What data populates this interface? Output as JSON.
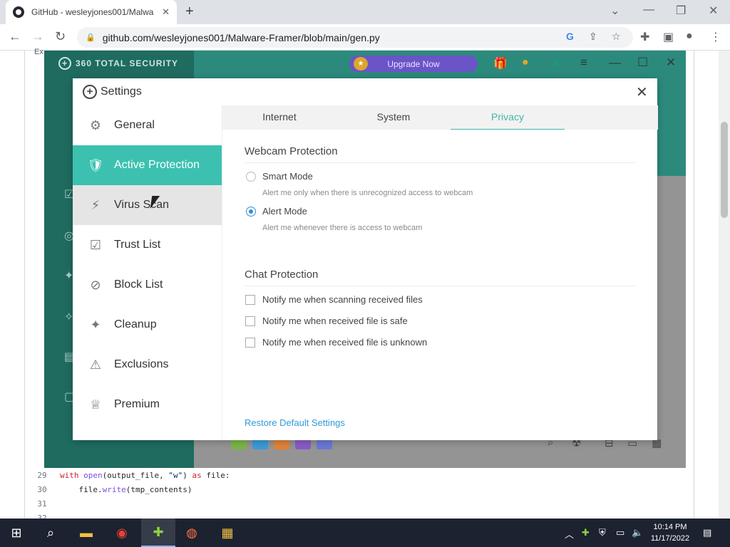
{
  "browser": {
    "tab_title": "GitHub - wesleyjones001/Malwa",
    "url": "github.com/wesleyjones001/Malware-Framer/blob/main/gen.py",
    "new_tab_glyph": "+",
    "close_tab_glyph": "✕"
  },
  "github_page": {
    "header_fragment": "Ex",
    "code_lines": [
      {
        "n": "29",
        "parts": [
          [
            "kw",
            "with "
          ],
          [
            "fn",
            "open"
          ],
          [
            "",
            "(output_file, "
          ],
          [
            "str",
            "\"w\""
          ],
          [
            "",
            ") "
          ],
          [
            "kw",
            "as "
          ],
          [
            "",
            "file:"
          ]
        ]
      },
      {
        "n": "30",
        "parts": [
          [
            "",
            "    file."
          ],
          [
            "fn",
            "write"
          ],
          [
            "",
            "(tmp_contents)"
          ]
        ]
      },
      {
        "n": "31",
        "parts": []
      },
      {
        "n": "32",
        "parts": []
      }
    ]
  },
  "app": {
    "brand": "360 TOTAL SECURITY",
    "upgrade_label": "Upgrade Now"
  },
  "settings": {
    "title": "Settings",
    "sidebar": [
      {
        "id": "general",
        "label": "General",
        "icon": "gear-icon",
        "glyph": "⚙"
      },
      {
        "id": "active-protection",
        "label": "Active Protection",
        "icon": "shield-monitor-icon",
        "glyph": "🛡"
      },
      {
        "id": "virus-scan",
        "label": "Virus Scan",
        "icon": "lightning-icon",
        "glyph": "⚡"
      },
      {
        "id": "trust-list",
        "label": "Trust List",
        "icon": "trust-list-icon",
        "glyph": "☑"
      },
      {
        "id": "block-list",
        "label": "Block List",
        "icon": "block-list-icon",
        "glyph": "⊘"
      },
      {
        "id": "cleanup",
        "label": "Cleanup",
        "icon": "broom-icon",
        "glyph": "✦"
      },
      {
        "id": "exclusions",
        "label": "Exclusions",
        "icon": "folder-warning-icon",
        "glyph": "⚠"
      },
      {
        "id": "premium",
        "label": "Premium",
        "icon": "crown-icon",
        "glyph": "♕"
      }
    ],
    "active_item": "Active Protection",
    "tabs": [
      "Internet",
      "System",
      "Privacy"
    ],
    "active_tab": "Privacy",
    "webcam": {
      "title": "Webcam Protection",
      "smart_label": "Smart Mode",
      "smart_desc": "Alert me only when there is unrecognized access to webcam",
      "alert_label": "Alert Mode",
      "alert_desc": "Alert me whenever there is access to webcam",
      "selected": "Alert Mode"
    },
    "chat": {
      "title": "Chat Protection",
      "options": [
        {
          "label": "Notify me when scanning received files",
          "checked": false
        },
        {
          "label": "Notify me when received file is safe",
          "checked": false
        },
        {
          "label": "Notify me when received file is unknown",
          "checked": false
        }
      ]
    },
    "restore_label": "Restore Default Settings"
  },
  "taskbar": {
    "time": "10:14 PM",
    "date": "11/17/2022"
  },
  "colors": {
    "accent_teal": "#3cc1b0",
    "link_blue": "#2f9bd6",
    "radio_blue": "#2f8fdc"
  }
}
